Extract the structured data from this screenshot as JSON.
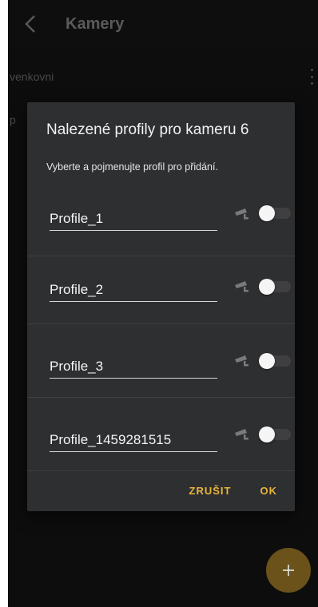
{
  "app_bar": {
    "title": "Kamery",
    "back_icon": "chevron-left-icon"
  },
  "list": {
    "items": [
      {
        "label": "venkovni"
      },
      {
        "label": "p"
      }
    ]
  },
  "dialog": {
    "title": "Nalezené profily pro kameru 6",
    "subtitle": "Vyberte a pojmenujte profil pro přidání.",
    "profiles": [
      {
        "name": "Profile_1",
        "enabled": false,
        "icon": "camera-icon"
      },
      {
        "name": "Profile_2",
        "enabled": false,
        "icon": "camera-icon"
      },
      {
        "name": "Profile_3",
        "enabled": false,
        "icon": "camera-icon"
      },
      {
        "name": "Profile_1459281515",
        "enabled": false,
        "icon": "camera-icon"
      }
    ],
    "cancel_label": "ZRUŠIT",
    "ok_label": "OK"
  },
  "fab": {
    "label": "+"
  },
  "colors": {
    "accent": "#e9b53a",
    "background": "#141414",
    "dialog": "#2e2f31",
    "fab": "#6a521a"
  }
}
